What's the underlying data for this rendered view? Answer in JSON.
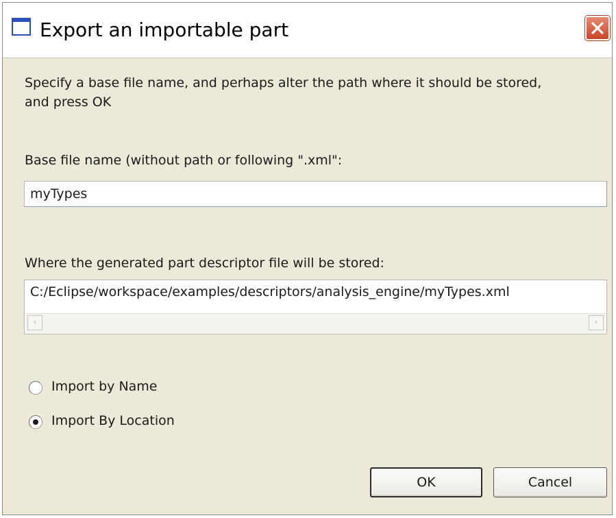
{
  "window": {
    "title": "Export an importable part"
  },
  "instruction": {
    "line1": "Specify a base file name, and perhaps alter the path where it should be stored,",
    "line2": "and press OK"
  },
  "base_file": {
    "label": "Base file name (without path or following \".xml\":",
    "value": "myTypes"
  },
  "storage": {
    "label": "Where the generated part descriptor file will be stored:",
    "path": "C:/Eclipse/workspace/examples/descriptors/analysis_engine/myTypes.xml"
  },
  "import_options": {
    "options": [
      {
        "label": "Import by Name",
        "selected": false
      },
      {
        "label": "Import By Location",
        "selected": true
      }
    ]
  },
  "buttons": {
    "ok": "OK",
    "cancel": "Cancel"
  },
  "colors": {
    "dialog_background": "#ece9d8",
    "close_button": "#c8462a",
    "title_icon": "#2b4fb8"
  },
  "icons": [
    "window-icon",
    "close-icon",
    "scroll-left-arrow-icon",
    "scroll-right-arrow-icon"
  ]
}
